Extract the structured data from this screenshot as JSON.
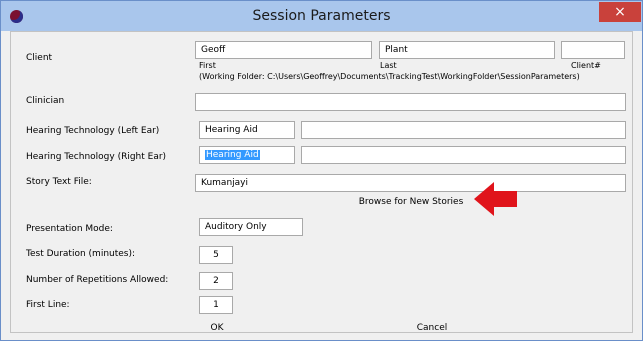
{
  "window": {
    "title": "Session Parameters",
    "close_glyph": "×",
    "icon": "app-icon"
  },
  "client": {
    "label": "Client",
    "first": "Geoff",
    "last": "Plant",
    "client_num": "",
    "first_caption": "First",
    "last_caption": "Last",
    "client_num_caption": "Client#",
    "working_folder": "(Working Folder: C:\\Users\\Geoffrey\\Documents\\TrackingTest\\WorkingFolder\\SessionParameters)"
  },
  "clinician": {
    "label": "Clinician",
    "value": ""
  },
  "hearing_left": {
    "label": "Hearing Technology (Left Ear)",
    "value": "Hearing Aid",
    "detail": ""
  },
  "hearing_right": {
    "label": "Hearing Technology (Right Ear)",
    "value": "Hearing Aid",
    "detail": ""
  },
  "story": {
    "label": "Story Text File:",
    "value": "Kumanjayi",
    "browse_label": "Browse for New Stories"
  },
  "presentation": {
    "label": "Presentation Mode:",
    "value": "Auditory Only"
  },
  "duration": {
    "label": "Test Duration (minutes):",
    "value": "5"
  },
  "repetitions": {
    "label": "Number of Repetitions Allowed:",
    "value": "2"
  },
  "first_line": {
    "label": "First Line:",
    "value": "1"
  },
  "buttons": {
    "ok": "OK",
    "cancel": "Cancel"
  },
  "colors": {
    "titlebar": "#a9c6ec",
    "close": "#c9413b",
    "arrow": "#e0141b",
    "selection": "#3399ff"
  }
}
